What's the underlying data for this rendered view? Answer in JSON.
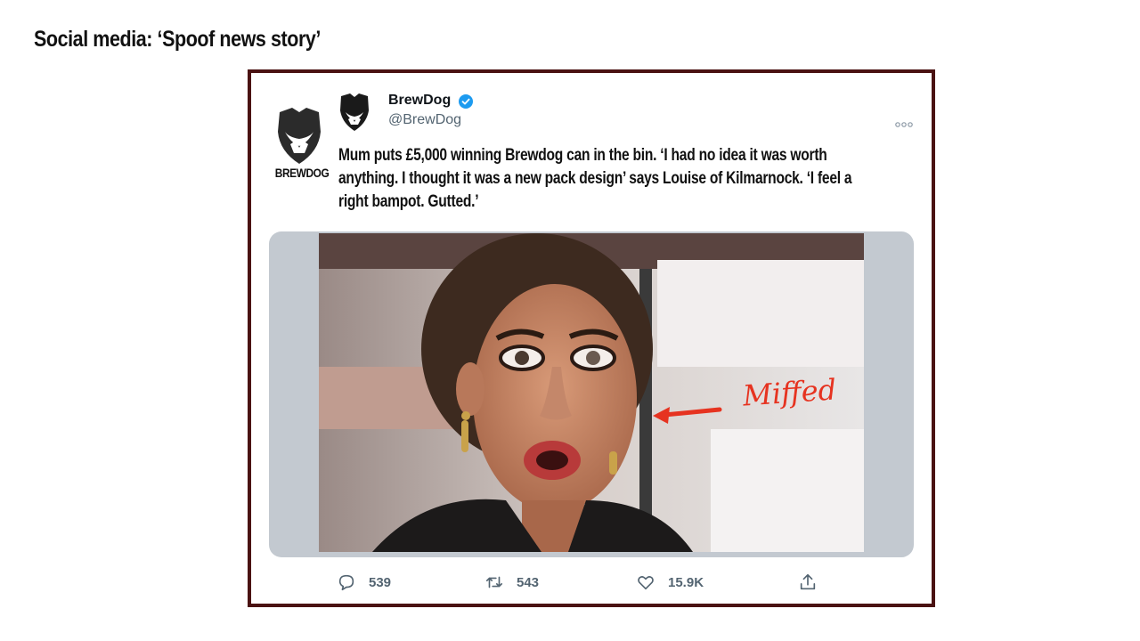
{
  "slide": {
    "title": "Social media: ‘Spoof news story’"
  },
  "tweet": {
    "brand_logo_text": "BREWDOG",
    "account_name": "BrewDog",
    "handle": "@BrewDog",
    "verified": true,
    "text": "Mum puts £5,000 winning Brewdog can in the bin. ‘I had no idea it was worth anything. I thought it was a new pack design’ says Louise of Kilmarnock. ‘I feel a right bampot. Gutted.’",
    "image": {
      "annotation": "Miffed",
      "annotation_color": "#e63320"
    },
    "actions": {
      "replies": "539",
      "retweets": "543",
      "likes": "15.9K"
    }
  },
  "colors": {
    "frame_border": "#4a1212",
    "verified_blue": "#1d9bf0",
    "secondary_text": "#536471"
  },
  "icons": [
    "shield-logo-icon",
    "verified-icon",
    "more-icon",
    "reply-icon",
    "retweet-icon",
    "like-icon",
    "share-icon"
  ]
}
